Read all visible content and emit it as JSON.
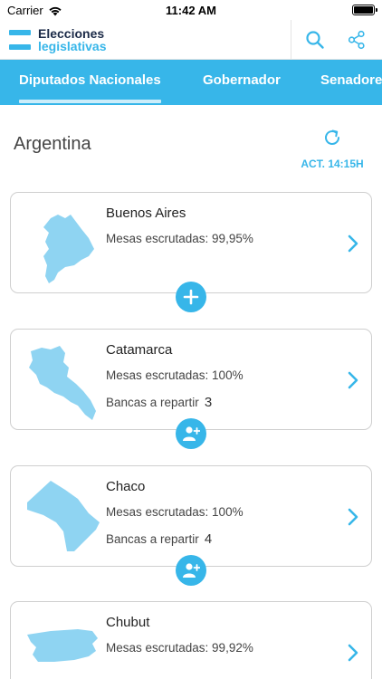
{
  "status_bar": {
    "carrier": "Carrier",
    "time": "11:42 AM"
  },
  "header": {
    "logo_line1": "Elecciones",
    "logo_line2": "legislativas"
  },
  "tabs": [
    {
      "label": "Diputados Nacionales",
      "active": true
    },
    {
      "label": "Gobernador",
      "active": false
    },
    {
      "label": "Senadores",
      "active": false
    }
  ],
  "region": {
    "title": "Argentina",
    "updated_label": "ACT. 14:15H"
  },
  "provinces": [
    {
      "name": "Buenos Aires",
      "mesas": "Mesas escrutadas: 99,95%",
      "bancas_label": "",
      "bancas_value": "",
      "action_icon": "plus-icon"
    },
    {
      "name": "Catamarca",
      "mesas": "Mesas escrutadas: 100%",
      "bancas_label": "Bancas a repartir",
      "bancas_value": "3",
      "action_icon": "add-person-icon"
    },
    {
      "name": "Chaco",
      "mesas": "Mesas escrutadas: 100%",
      "bancas_label": "Bancas a repartir",
      "bancas_value": "4",
      "action_icon": "add-person-icon"
    },
    {
      "name": "Chubut",
      "mesas": "Mesas escrutadas: 99,92%",
      "bancas_label": "",
      "bancas_value": "",
      "action_icon": ""
    }
  ],
  "colors": {
    "accent": "#37b6e9",
    "navy": "#1b2a47",
    "map_fill": "#8fd4f2"
  }
}
